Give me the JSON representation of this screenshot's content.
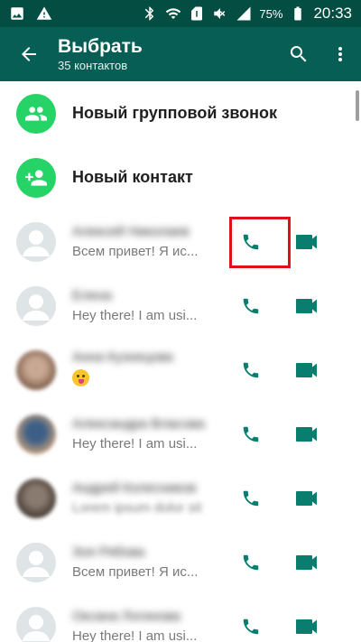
{
  "status_bar": {
    "battery": "75%",
    "time": "20:33",
    "icons_left": [
      "image-icon",
      "warning-icon"
    ],
    "icons_right": [
      "bluetooth-icon",
      "wifi-icon",
      "sim-icon",
      "mute-icon",
      "signal-icon",
      "battery-icon"
    ]
  },
  "app_bar": {
    "title": "Выбрать",
    "subtitle": "35 контактов",
    "icons": [
      "back-arrow-icon",
      "search-icon",
      "more-vert-icon"
    ]
  },
  "actions": [
    {
      "label": "Новый групповой звонок",
      "icon": "group-icon"
    },
    {
      "label": "Новый контакт",
      "icon": "add-person-icon"
    }
  ],
  "contacts": [
    {
      "name": "Алексей Николаев",
      "status": "Всем привет! Я ис...",
      "status_blurred": false,
      "avatar": "default"
    },
    {
      "name": "Елена",
      "status": "Hey there! I am usi...",
      "status_blurred": false,
      "avatar": "default"
    },
    {
      "name": "Анна Кузнецова",
      "status": "",
      "status_blurred": false,
      "emoji": true,
      "avatar": "photo"
    },
    {
      "name": "Александра Власова",
      "status": "Hey there! I am usi...",
      "status_blurred": false,
      "avatar": "photo"
    },
    {
      "name": "Андрей Колесников",
      "status": "Lorem ipsum dolor sit",
      "status_blurred": true,
      "avatar": "photo"
    },
    {
      "name": "Зоя Рябова",
      "status": "Всем привет! Я ис...",
      "status_blurred": false,
      "avatar": "default"
    },
    {
      "name": "Оксана Логинова",
      "status": "Hey there! I am usi...",
      "status_blurred": false,
      "avatar": "default"
    }
  ],
  "colors": {
    "status_bar": "#044d42",
    "app_bar": "#075e54",
    "accent": "#25d366",
    "call_icon": "#0a7e6e",
    "highlight": "#e0101a"
  }
}
